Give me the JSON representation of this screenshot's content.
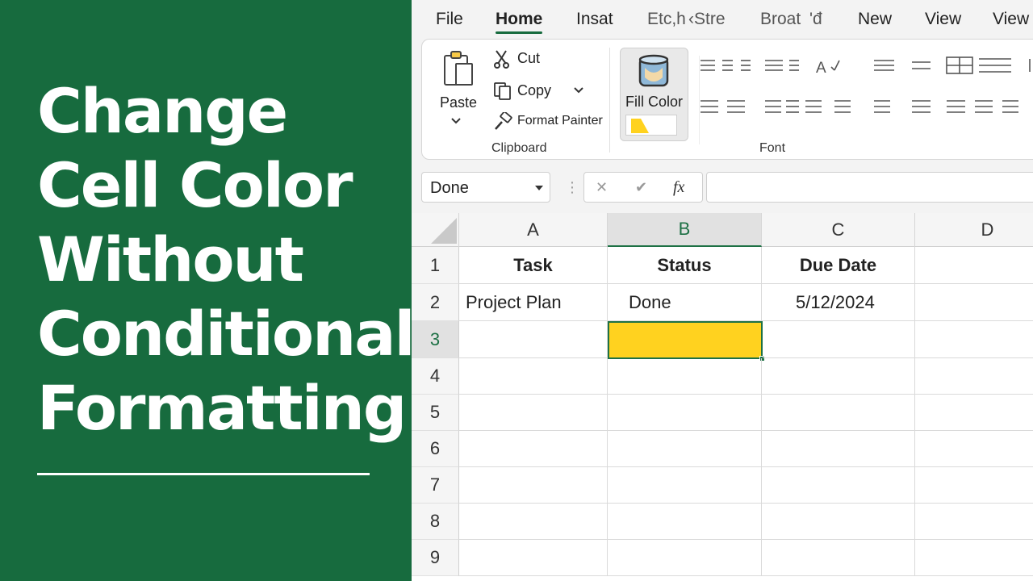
{
  "promo": {
    "title_lines": [
      "Change",
      "Cell Color",
      "Without",
      "Conditional",
      "Formatting"
    ]
  },
  "menu": {
    "items": [
      "File",
      "Home",
      "Insat",
      "Etc,h",
      "‹Stre",
      "Broat",
      "'đ",
      "New",
      "View",
      "View"
    ],
    "active": "Home"
  },
  "ribbon": {
    "clipboard": {
      "paste_label": "Paste",
      "cut_label": "Cut",
      "copy_label": "Copy",
      "format_painter_label": "Format Painter",
      "group_label": "Clipboard"
    },
    "fill_color": {
      "label": "Fill Color",
      "swatch_color": "#FFD21F"
    },
    "font_group_label": "Font"
  },
  "formula_bar": {
    "name_box": "Done",
    "cancel_icon": "✕",
    "enter_icon": "✔",
    "fx_label": "fx",
    "value": ""
  },
  "sheet": {
    "columns": [
      "A",
      "B",
      "C",
      "D"
    ],
    "selected_column": "B",
    "rows": [
      "1",
      "2",
      "3",
      "4",
      "5",
      "6",
      "7",
      "8",
      "9"
    ],
    "selected_row": "3",
    "cells": {
      "A1": "Task",
      "B1": "Status",
      "C1": "Due Date",
      "A2": "Project Plan",
      "B2": "Done",
      "C2": "5/12/2024"
    },
    "selected_cell": "B3",
    "selected_fill": "#FFD21F",
    "accent_color": "#1E7145"
  },
  "colors": {
    "promo_bg": "#176B3E",
    "accent": "#1E7145",
    "fill_yellow": "#FFD21F"
  }
}
